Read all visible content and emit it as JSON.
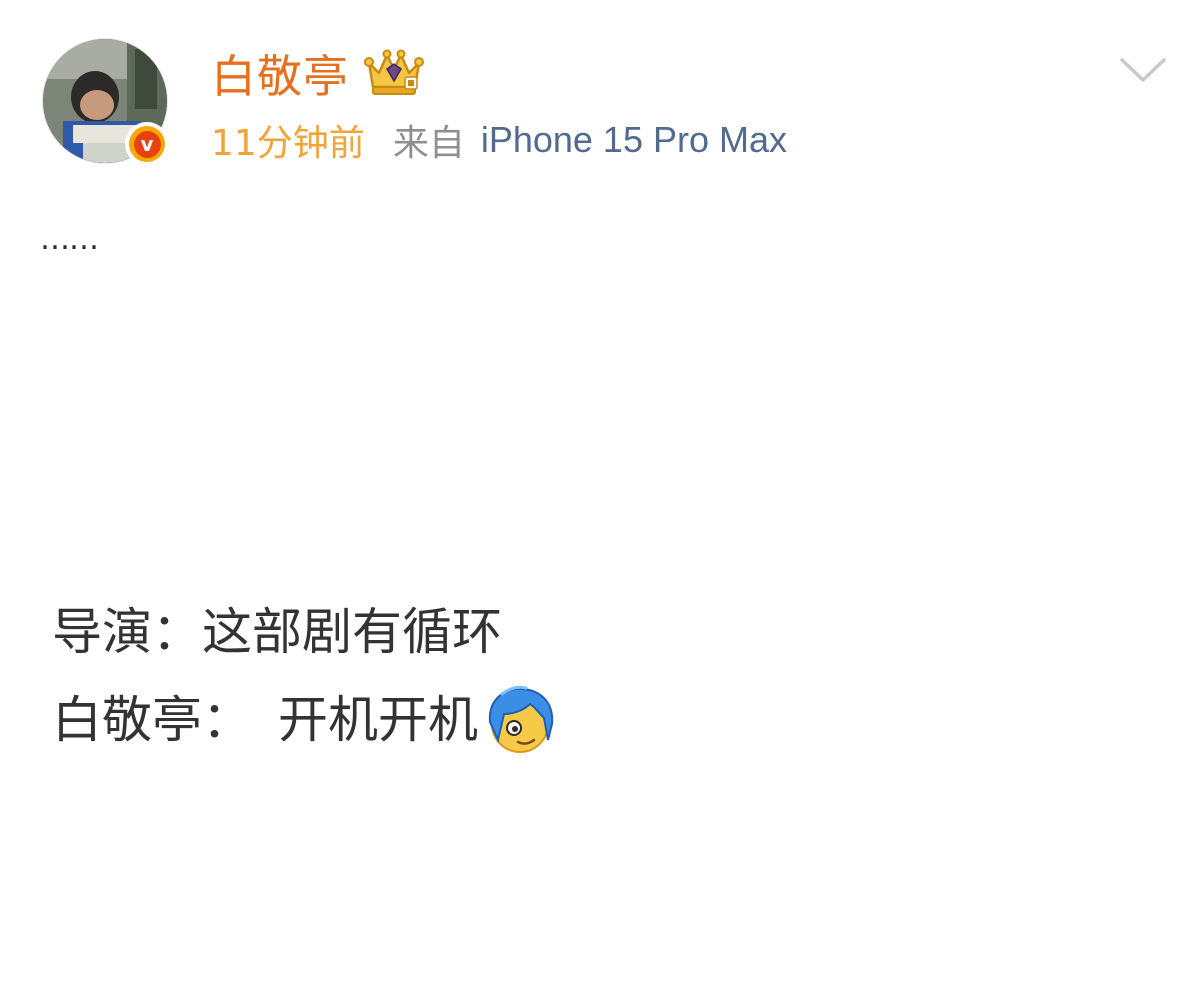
{
  "post": {
    "author": {
      "name": "白敬亭",
      "verified_badge_letter": "v",
      "accent_color": "#e5701f",
      "badge_color": "#f7a800"
    },
    "meta": {
      "timestamp": "11分钟前",
      "source_prefix": "来自",
      "source_device": "iPhone 15 Pro Max"
    },
    "icons": {
      "crown": "crown-icon",
      "chevron": "chevron-down-icon",
      "emoji": "blue-hair-face-emoji-icon"
    },
    "body": {
      "ellipsis": "……",
      "lines": [
        {
          "speaker": "导演：",
          "text": "这部剧有循环"
        },
        {
          "speaker": "白敬亭：",
          "text": "开机开机"
        }
      ]
    }
  }
}
